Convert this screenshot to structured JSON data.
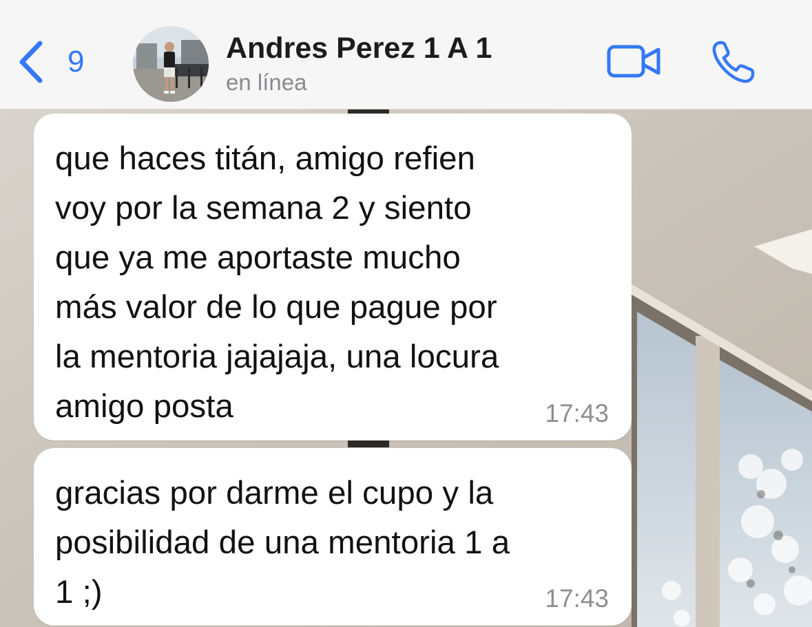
{
  "header": {
    "back_count": "9",
    "contact_name": "Andres Perez 1 A 1",
    "contact_status": "en línea",
    "icons": {
      "back": "chevron-left-icon",
      "video": "video-camera-icon",
      "call": "phone-icon"
    },
    "accent_color": "#3478f6"
  },
  "messages": [
    {
      "text": "que haces titán, amigo refien\nvoy por la semana 2 y siento\nque ya me aportaste mucho\nmás valor de lo que pague por\nla mentoria jajajaja, una locura\namigo posta",
      "time": "17:43"
    },
    {
      "text": "gracias por darme el cupo y la\nposibilidad de una mentoria 1 a\n1 ;)",
      "time": "17:43"
    }
  ]
}
